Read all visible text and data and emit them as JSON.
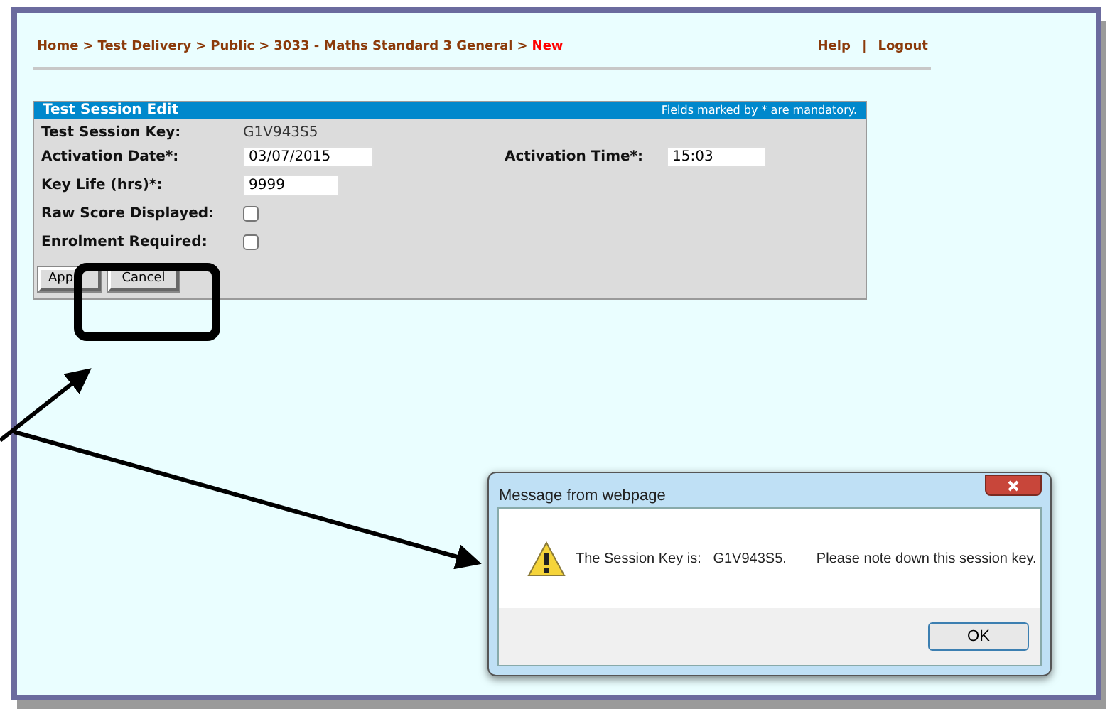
{
  "breadcrumb": {
    "separator": ">",
    "items": [
      {
        "label": "Home",
        "current": false
      },
      {
        "label": "Test Delivery",
        "current": false
      },
      {
        "label": "Public",
        "current": false
      },
      {
        "label": "3033 - Maths Standard 3 General",
        "current": false
      },
      {
        "label": "New",
        "current": true
      }
    ]
  },
  "header_links": {
    "separator": "|",
    "items": [
      "Help",
      "Logout"
    ]
  },
  "form": {
    "title": "Test Session Edit",
    "note": "Fields marked by * are mandatory.",
    "rows": [
      [
        {
          "label": "Test Session Key:",
          "kind": "text",
          "value": "G1V943S5"
        }
      ],
      [
        {
          "label": "Activation Date*:",
          "kind": "input",
          "value": "03/07/2015"
        },
        {
          "label": "Activation Time*:",
          "kind": "input",
          "value": "15:03"
        }
      ],
      [
        {
          "label": "Key Life (hrs)*:",
          "kind": "input",
          "value": "9999"
        }
      ],
      [
        {
          "label": "Raw Score Displayed:",
          "kind": "checkbox",
          "checked": false
        }
      ],
      [
        {
          "label": "Enrolment Required:",
          "kind": "checkbox",
          "checked": false
        }
      ]
    ],
    "buttons": [
      "App",
      "Cancel"
    ]
  },
  "dialog": {
    "title": "Message from webpage",
    "message": "The Session Key is:   G1V943S5.",
    "note": "Please note down this session key.",
    "button": "OK"
  }
}
